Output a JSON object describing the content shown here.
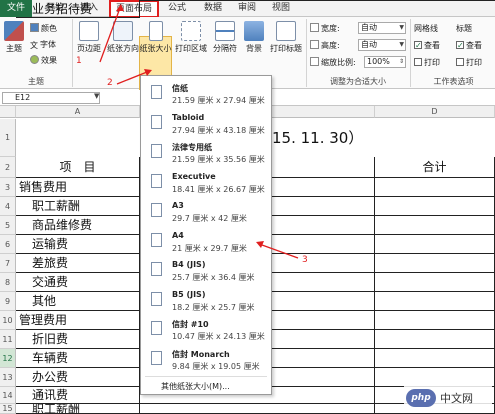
{
  "tabs": [
    {
      "label": "文件",
      "id": "file"
    },
    {
      "label": "开始",
      "id": "home"
    },
    {
      "label": "插入",
      "id": "insert"
    },
    {
      "label": "页面布局",
      "id": "pagelayout"
    },
    {
      "label": "公式",
      "id": "formulas"
    },
    {
      "label": "数据",
      "id": "data"
    },
    {
      "label": "审阅",
      "id": "review"
    },
    {
      "label": "视图",
      "id": "view"
    }
  ],
  "ribbon": {
    "theme": {
      "label": "主题",
      "colors": "颜色",
      "fonts": "字体",
      "effects": "效果",
      "group_label": "主题"
    },
    "margins": "页边距",
    "orientation": "纸张方向",
    "size": "纸张大小",
    "print_area": "打印区域",
    "breaks": "分隔符",
    "background": "背景",
    "print_titles": "打印标题",
    "width_label": "宽度:",
    "height_label": "高度:",
    "scale_label": "缩放比例:",
    "width_value": "自动",
    "height_value": "自动",
    "scale_value": "100%",
    "fit_group_label": "调整为合适大小",
    "gridlines_label": "网格线",
    "headings_label": "标题",
    "view_label": "查看",
    "print_label": "打印",
    "sheet_options_label": "工作表选项"
  },
  "namebox": "E12",
  "columns": [
    "A",
    "D"
  ],
  "rows": [
    "1",
    "2",
    "3",
    "4",
    "5",
    "6",
    "7",
    "8",
    "9",
    "10",
    "11",
    "12",
    "13",
    "14",
    "15"
  ],
  "sheet": {
    "title_fragment": "15. 11. 30）",
    "header_item": "项　目",
    "header_mid": "内",
    "header_total": "合计",
    "items": [
      "销售费用",
      "职工薪酬",
      "商品维修费",
      "运输费",
      "差旅费",
      "交通费",
      "其他",
      "管理费用",
      "折旧费",
      "车辆费",
      "办公费",
      "通讯费",
      "职工薪酬",
      "业务招待费"
    ]
  },
  "paper_sizes": [
    {
      "name": "信纸",
      "dim": "21.59 厘米 x 27.94 厘米"
    },
    {
      "name": "Tabloid",
      "dim": "27.94 厘米 x 43.18 厘米"
    },
    {
      "name": "法律专用纸",
      "dim": "21.59 厘米 x 35.56 厘米"
    },
    {
      "name": "Executive",
      "dim": "18.41 厘米 x 26.67 厘米"
    },
    {
      "name": "A3",
      "dim": "29.7 厘米 x 42 厘米"
    },
    {
      "name": "A4",
      "dim": "21 厘米 x 29.7 厘米"
    },
    {
      "name": "B4 (JIS)",
      "dim": "25.7 厘米 x 36.4 厘米"
    },
    {
      "name": "B5 (JIS)",
      "dim": "18.2 厘米 x 25.7 厘米"
    },
    {
      "name": "信封 #10",
      "dim": "10.47 厘米 x 24.13 厘米"
    },
    {
      "name": "信封 Monarch",
      "dim": "9.84 厘米 x 19.05 厘米"
    }
  ],
  "more_sizes": "其他纸张大小(M)...",
  "annotations": [
    "1",
    "2",
    "3"
  ],
  "watermark": {
    "logo": "php",
    "text": "中文网"
  },
  "colors": {
    "excel_green": "#217346",
    "annotation_red": "#e01f1f",
    "highlight": "#fde7a6"
  }
}
